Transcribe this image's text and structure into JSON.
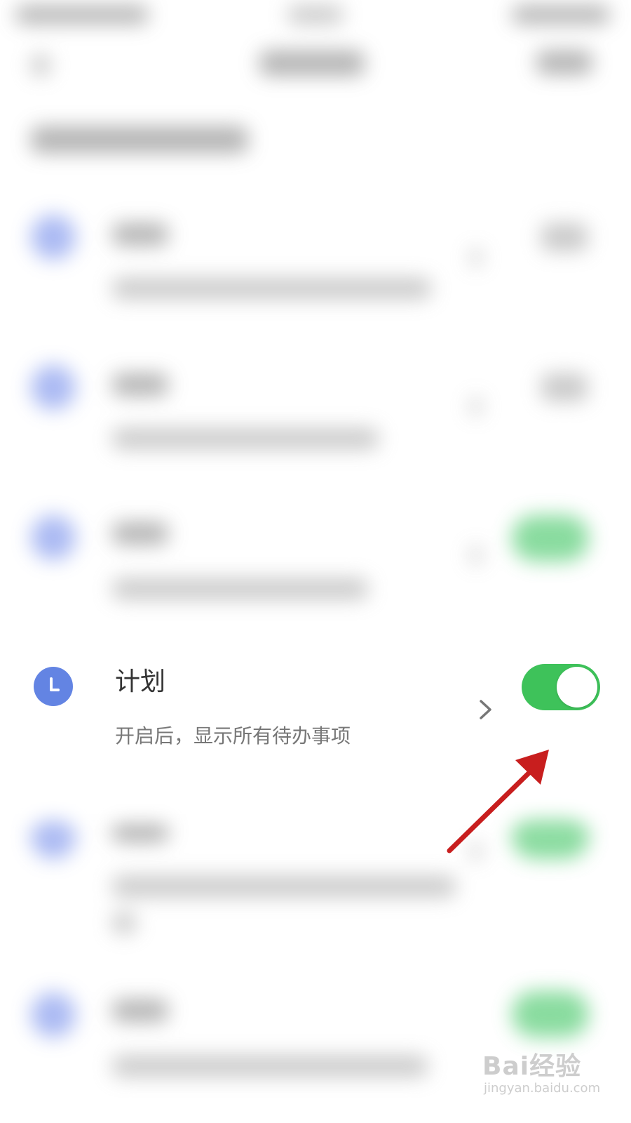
{
  "plan_item": {
    "title": "计划",
    "description": "开启后，显示所有待办事项",
    "toggle_on": true,
    "icon": "clock-icon",
    "chevron_icon": "chevron-right-icon"
  },
  "annotation": {
    "type": "arrow",
    "target": "plan-toggle",
    "color": "#c81e1e"
  },
  "watermark": {
    "logo": "Bai经验",
    "url": "jingyan.baidu.com"
  },
  "colors": {
    "icon_blue": "#6384e3",
    "toggle_green": "#3ec25a",
    "title_text": "#333333",
    "desc_text": "#777777"
  }
}
